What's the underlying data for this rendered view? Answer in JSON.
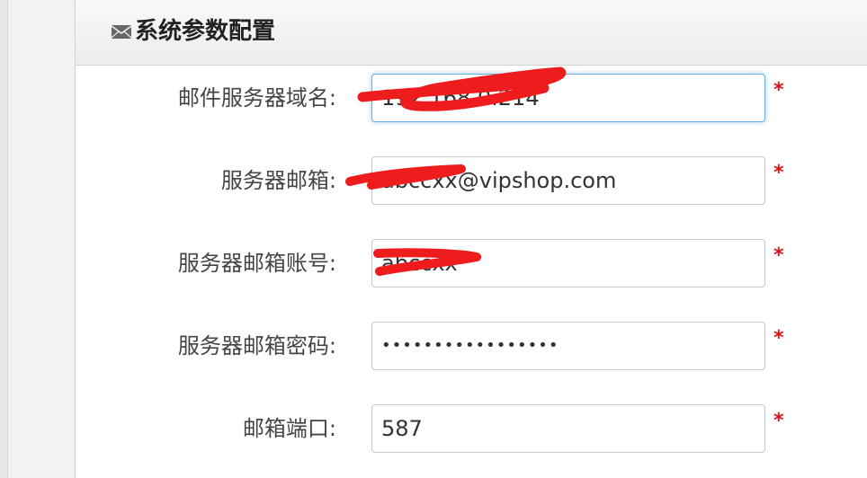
{
  "panel": {
    "title": "系统参数配置",
    "title_icon": "envelope-icon"
  },
  "form": {
    "fields": [
      {
        "label": "邮件服务器域名:",
        "value": "192.168.0.214",
        "required_mark": "*"
      },
      {
        "label": "服务器邮箱:",
        "value": "abccxx@vipshop.com",
        "required_mark": "*"
      },
      {
        "label": "服务器邮箱账号:",
        "value": "abccxx",
        "required_mark": "*"
      },
      {
        "label": "服务器邮箱密码:",
        "value": "•••••••••••••••••",
        "required_mark": "*"
      },
      {
        "label": "邮箱端口:",
        "value": "587",
        "required_mark": "*"
      }
    ]
  },
  "colors": {
    "required": "#e01010",
    "redaction": "#ee1c1c",
    "focus_border": "#66afe9"
  }
}
